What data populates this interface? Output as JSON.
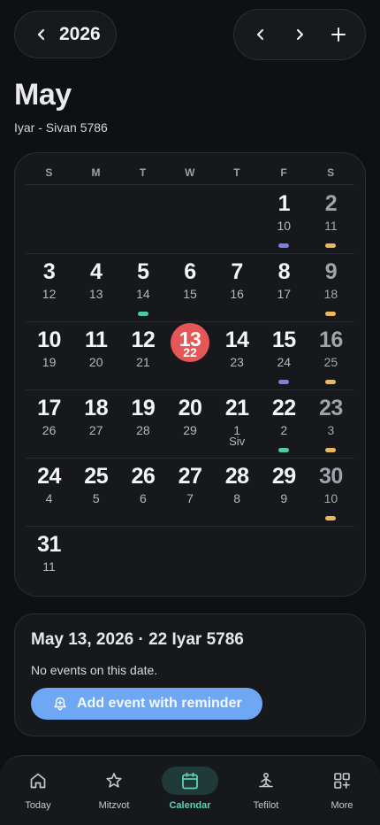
{
  "header": {
    "year": "2026",
    "month": "May",
    "hebrew_range": "Iyar - Sivan 5786"
  },
  "calendar": {
    "weekdays": [
      "S",
      "M",
      "T",
      "W",
      "T",
      "F",
      "S"
    ],
    "weeks": [
      [
        null,
        null,
        null,
        null,
        null,
        {
          "day": "1",
          "heb": "10",
          "dot": "purple"
        },
        {
          "day": "2",
          "heb": "11",
          "dot": "yellow",
          "sat": true
        }
      ],
      [
        {
          "day": "3",
          "heb": "12"
        },
        {
          "day": "4",
          "heb": "13"
        },
        {
          "day": "5",
          "heb": "14",
          "dot": "teal"
        },
        {
          "day": "6",
          "heb": "15"
        },
        {
          "day": "7",
          "heb": "16"
        },
        {
          "day": "8",
          "heb": "17"
        },
        {
          "day": "9",
          "heb": "18",
          "dot": "yellow",
          "sat": true
        }
      ],
      [
        {
          "day": "10",
          "heb": "19"
        },
        {
          "day": "11",
          "heb": "20"
        },
        {
          "day": "12",
          "heb": "21"
        },
        {
          "day": "13",
          "heb": "22",
          "today": true
        },
        {
          "day": "14",
          "heb": "23"
        },
        {
          "day": "15",
          "heb": "24",
          "dot": "purple"
        },
        {
          "day": "16",
          "heb": "25",
          "dot": "yellow",
          "sat": true
        }
      ],
      [
        {
          "day": "17",
          "heb": "26"
        },
        {
          "day": "18",
          "heb": "27"
        },
        {
          "day": "19",
          "heb": "28"
        },
        {
          "day": "20",
          "heb": "29"
        },
        {
          "day": "21",
          "heb": "1",
          "heb_month": "Siv"
        },
        {
          "day": "22",
          "heb": "2",
          "dot": "teal"
        },
        {
          "day": "23",
          "heb": "3",
          "dot": "yellow",
          "sat": true
        }
      ],
      [
        {
          "day": "24",
          "heb": "4"
        },
        {
          "day": "25",
          "heb": "5"
        },
        {
          "day": "26",
          "heb": "6"
        },
        {
          "day": "27",
          "heb": "7"
        },
        {
          "day": "28",
          "heb": "8"
        },
        {
          "day": "29",
          "heb": "9"
        },
        {
          "day": "30",
          "heb": "10",
          "dot": "yellow",
          "sat": true
        }
      ],
      [
        {
          "day": "31",
          "heb": "11"
        },
        null,
        null,
        null,
        null,
        null,
        null
      ]
    ]
  },
  "selected": {
    "title": "May 13, 2026 · 22 Iyar 5786",
    "empty_text": "No events on this date.",
    "add_button_label": "Add event with reminder"
  },
  "bottom_nav": {
    "items": [
      {
        "label": "Today",
        "icon": "home-icon"
      },
      {
        "label": "Mitzvot",
        "icon": "star-icon"
      },
      {
        "label": "Calendar",
        "icon": "calendar-icon",
        "active": true
      },
      {
        "label": "Tefilot",
        "icon": "prayer-icon"
      },
      {
        "label": "More",
        "icon": "grid-plus-icon"
      }
    ]
  },
  "colors": {
    "today": "#e55757",
    "dot_purple": "#7b7fe6",
    "dot_yellow": "#e8b85a",
    "dot_teal": "#4fc9aa",
    "accent_button": "#6ea8f5",
    "nav_active": "#5fd1b8"
  }
}
